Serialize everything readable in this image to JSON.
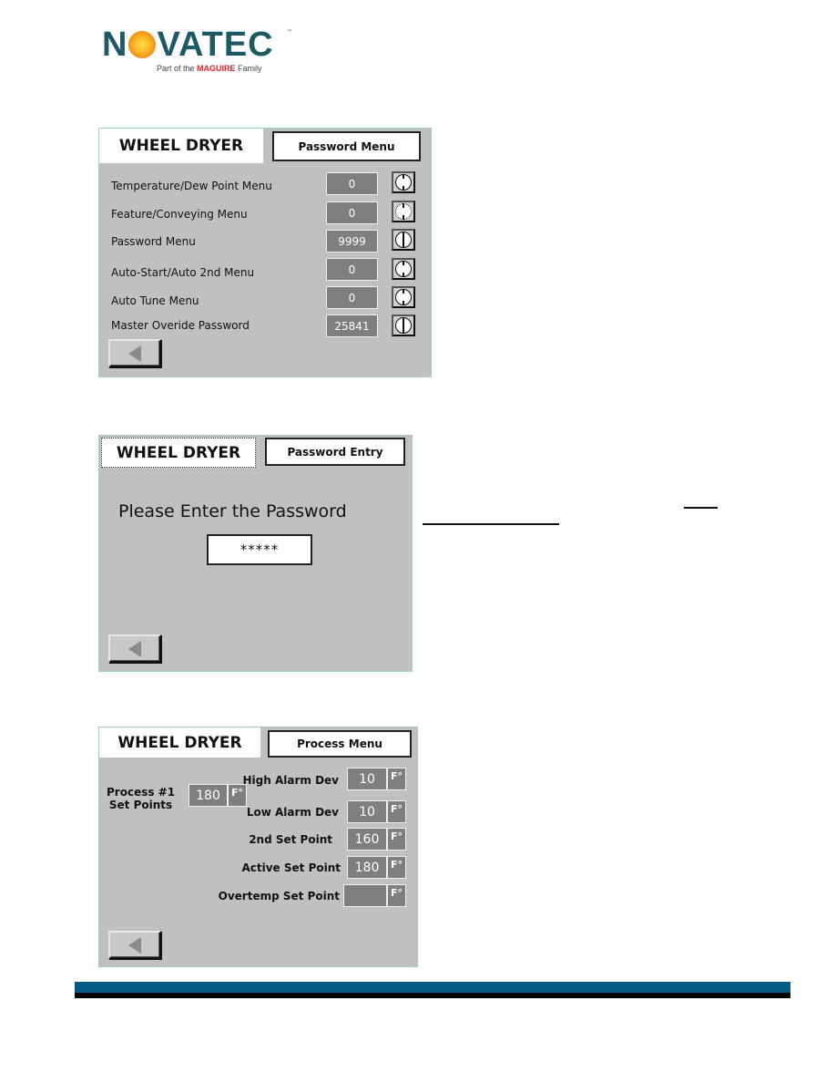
{
  "logo": {
    "brand": "N",
    "brand_rest": "VATEC",
    "trademark": "™",
    "tagline_prefix": "Part of the ",
    "tagline_brand": "MAGUIRE",
    "tagline_suffix": " Family"
  },
  "panels": [
    {
      "title": "WHEEL DRYER",
      "screen": "Password Menu",
      "rows": [
        {
          "label": "Temperature/Dew Point Menu",
          "value": "0",
          "icon": "dial-ticks-icon"
        },
        {
          "label": "Feature/Conveying Menu",
          "value": "0",
          "icon": "dial-dotted-icon"
        },
        {
          "label": "Password Menu",
          "value": "9999",
          "icon": "dial-split-icon"
        },
        {
          "label": "Auto-Start/Auto 2nd Menu",
          "value": "0",
          "icon": "dial-ticks-icon"
        },
        {
          "label": "Auto Tune Menu",
          "value": "0",
          "icon": "dial-ticks-icon"
        },
        {
          "label": "Master Overide Password",
          "value": "25841",
          "icon": "dial-split-icon"
        }
      ]
    },
    {
      "title": "WHEEL DRYER",
      "screen": "Password Entry",
      "prompt": "Please Enter the Password",
      "password_mask": "*****"
    },
    {
      "title": "WHEEL DRYER",
      "screen": "Process Menu",
      "process_label_line1": "Process #1",
      "process_label_line2": "Set Points",
      "process_value": "180",
      "unit": "F°",
      "fields": [
        {
          "label": "High Alarm Dev",
          "value": "10"
        },
        {
          "label": "Low Alarm Dev",
          "value": "10"
        },
        {
          "label": "2nd Set Point",
          "value": "160"
        },
        {
          "label": "Active Set Point",
          "value": "180"
        },
        {
          "label": "Overtemp Set Point",
          "value": ""
        }
      ]
    }
  ],
  "colors": {
    "panel_bg": "#c0c0c0",
    "value_box": "#7f7f7f",
    "footer_blue": "#005a84",
    "logo_text": "#1e5a66",
    "logo_accent": "#d9252b"
  }
}
